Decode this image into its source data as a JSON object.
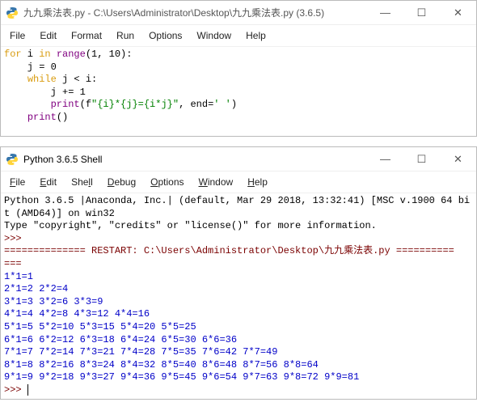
{
  "window1": {
    "title": "九九乘法表.py - C:\\Users\\Administrator\\Desktop\\九九乘法表.py (3.6.5)",
    "menu": [
      "File",
      "Edit",
      "Format",
      "Run",
      "Options",
      "Window",
      "Help"
    ],
    "code": {
      "l1a": "for",
      "l1b": " i ",
      "l1c": "in",
      "l1d": " ",
      "l1e": "range",
      "l1f": "(1, 10):",
      "l2": "    j = 0",
      "l3a": "    ",
      "l3b": "while",
      "l3c": " j < i:",
      "l4": "        j += 1",
      "l5a": "        ",
      "l5b": "print",
      "l5c": "(f",
      "l5d": "\"{i}*{j}={i*j}\"",
      "l5e": ", end=",
      "l5f": "' '",
      "l5g": ")",
      "l6a": "    ",
      "l6b": "print",
      "l6c": "()"
    }
  },
  "window2": {
    "title": "Python 3.6.5 Shell",
    "menu": [
      {
        "pre": "",
        "hot": "F",
        "post": "ile"
      },
      {
        "pre": "",
        "hot": "E",
        "post": "dit"
      },
      {
        "pre": "She",
        "hot": "l",
        "post": "l"
      },
      {
        "pre": "",
        "hot": "D",
        "post": "ebug"
      },
      {
        "pre": "",
        "hot": "O",
        "post": "ptions"
      },
      {
        "pre": "",
        "hot": "W",
        "post": "indow"
      },
      {
        "pre": "",
        "hot": "H",
        "post": "elp"
      }
    ],
    "banner1": "Python 3.6.5 |Anaconda, Inc.| (default, Mar 29 2018, 13:32:41) [MSC v.1900 64 bi",
    "banner1b": "t (AMD64)] on win32",
    "banner2": "Type \"copyright\", \"credits\" or \"license()\" for more information.",
    "prompt": ">>>",
    "restart": "============== RESTART: C:\\Users\\Administrator\\Desktop\\九九乘法表.py ==========",
    "restart2": "===",
    "output": [
      "1*1=1",
      "2*1=2 2*2=4",
      "3*1=3 3*2=6 3*3=9",
      "4*1=4 4*2=8 4*3=12 4*4=16",
      "5*1=5 5*2=10 5*3=15 5*4=20 5*5=25",
      "6*1=6 6*2=12 6*3=18 6*4=24 6*5=30 6*6=36",
      "7*1=7 7*2=14 7*3=21 7*4=28 7*5=35 7*6=42 7*7=49",
      "8*1=8 8*2=16 8*3=24 8*4=32 8*5=40 8*6=48 8*7=56 8*8=64",
      "9*1=9 9*2=18 9*3=27 9*4=36 9*5=45 9*6=54 9*7=63 9*8=72 9*9=81"
    ]
  },
  "winbtns": {
    "min": "—",
    "max": "☐",
    "close": "✕"
  }
}
